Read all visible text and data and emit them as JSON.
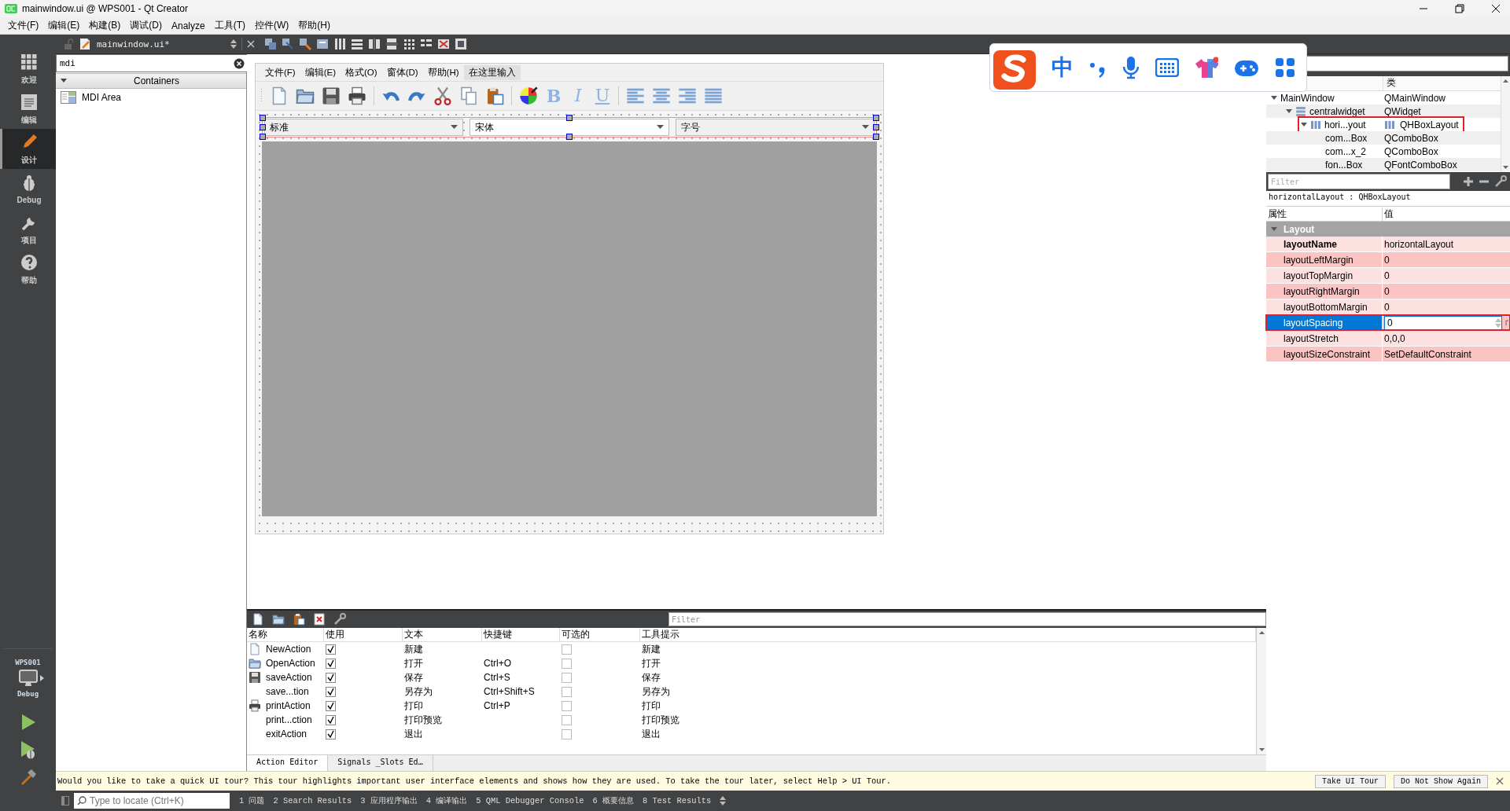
{
  "window": {
    "title": "mainwindow.ui @ WPS001 - Qt Creator"
  },
  "menu": [
    "文件(F)",
    "编辑(E)",
    "构建(B)",
    "调试(D)",
    "Analyze",
    "工具(T)",
    "控件(W)",
    "帮助(H)"
  ],
  "modes": [
    {
      "kind": "welcome",
      "label": "欢迎",
      "selected": false
    },
    {
      "kind": "edit",
      "label": "编辑",
      "selected": false
    },
    {
      "kind": "design",
      "label": "设计",
      "selected": true
    },
    {
      "kind": "debug",
      "label": "Debug",
      "selected": false
    },
    {
      "kind": "projects",
      "label": "项目",
      "selected": false
    },
    {
      "kind": "help",
      "label": "帮助",
      "selected": false
    }
  ],
  "target": {
    "project": "WPS001",
    "build": "Debug"
  },
  "document": {
    "file": "mainwindow.ui*"
  },
  "widget_box": {
    "search": {
      "value": "mdi"
    },
    "categories": [
      {
        "label": "Containers",
        "expanded": true,
        "items": [
          {
            "label": "MDI Area"
          }
        ]
      }
    ]
  },
  "form": {
    "menu": [
      {
        "label": "文件(F)",
        "selected": false
      },
      {
        "label": "编辑(E)",
        "selected": false
      },
      {
        "label": "格式(O)",
        "selected": false
      },
      {
        "label": "窗体(D)",
        "selected": false
      },
      {
        "label": "帮助(H)",
        "selected": false
      },
      {
        "label": "在这里输入",
        "selected": true
      }
    ],
    "format_buttons": [
      "B",
      "I",
      "U"
    ],
    "combos": [
      {
        "kind": "combo",
        "value": "标准"
      },
      {
        "kind": "font",
        "value": "宋体"
      },
      {
        "kind": "combo",
        "value": "字号"
      }
    ]
  },
  "action_editor": {
    "filter": {
      "placeholder": "Filter"
    },
    "columns": [
      "名称",
      "使用",
      "文本",
      "快捷键",
      "可选的",
      "工具提示"
    ],
    "rows": [
      {
        "kind": "new",
        "name": "NewAction",
        "used": true,
        "text": "新建",
        "shortcut": "",
        "checkable": false,
        "tooltip": "新建"
      },
      {
        "kind": "open",
        "name": "OpenAction",
        "used": true,
        "text": "打开",
        "shortcut": "Ctrl+O",
        "checkable": false,
        "tooltip": "打开"
      },
      {
        "kind": "save",
        "name": "saveAction",
        "used": true,
        "text": "保存",
        "shortcut": "Ctrl+S",
        "checkable": false,
        "tooltip": "保存"
      },
      {
        "kind": "plain",
        "name": "save...tion",
        "used": true,
        "text": "另存为",
        "shortcut": "Ctrl+Shift+S",
        "checkable": false,
        "tooltip": "另存为"
      },
      {
        "kind": "print",
        "name": "printAction",
        "used": true,
        "text": "打印",
        "shortcut": "Ctrl+P",
        "checkable": false,
        "tooltip": "打印"
      },
      {
        "kind": "plain",
        "name": "print...ction",
        "used": true,
        "text": "打印预览",
        "shortcut": "",
        "checkable": false,
        "tooltip": "打印预览"
      },
      {
        "kind": "plain",
        "name": "exitAction",
        "used": true,
        "text": "退出",
        "shortcut": "",
        "checkable": false,
        "tooltip": "退出"
      }
    ],
    "tabs": [
      {
        "label": "Action Editor",
        "selected": true
      },
      {
        "label": "Signals _Slots Ed…",
        "selected": false
      }
    ]
  },
  "ime_toolbar": {
    "mode": "中"
  },
  "object_inspector": {
    "columns": [
      "类"
    ],
    "tree": [
      {
        "name": "MainWindow",
        "class": "QMainWindow",
        "expanded": true,
        "highlighted": false,
        "children": [
          {
            "kind": "widget",
            "name": "centralwidget",
            "class": "QWidget",
            "expanded": true,
            "highlighted": false,
            "children": [
              {
                "kind": "hlayout",
                "name": "hori...yout",
                "class": "QHBoxLayout",
                "expanded": true,
                "highlighted": true,
                "children": [
                  {
                    "name": "com...Box",
                    "class": "QComboBox",
                    "highlighted": false
                  },
                  {
                    "name": "com...x_2",
                    "class": "QComboBox",
                    "highlighted": false
                  },
                  {
                    "name": "fon...Box",
                    "class": "QFontComboBox",
                    "highlighted": false
                  }
                ]
              }
            ]
          }
        ]
      }
    ]
  },
  "property_editor": {
    "filter": {
      "placeholder": "Filter"
    },
    "object": "horizontalLayout : QHBoxLayout",
    "columns": [
      "属性",
      "值"
    ],
    "groups": [
      {
        "label": "Layout",
        "expanded": true,
        "properties": [
          {
            "name": "layoutName",
            "value": "horizontalLayout",
            "modified": true,
            "selected": false,
            "highlighted": false
          },
          {
            "name": "layoutLeftMargin",
            "value": "0",
            "modified": false,
            "selected": false,
            "highlighted": false
          },
          {
            "name": "layoutTopMargin",
            "value": "0",
            "modified": false,
            "selected": false,
            "highlighted": false
          },
          {
            "name": "layoutRightMargin",
            "value": "0",
            "modified": false,
            "selected": false,
            "highlighted": false
          },
          {
            "name": "layoutBottomMargin",
            "value": "0",
            "modified": false,
            "selected": false,
            "highlighted": false
          },
          {
            "name": "layoutSpacing",
            "value": "0",
            "modified": false,
            "selected": true,
            "highlighted": true
          },
          {
            "name": "layoutStretch",
            "value": "0,0,0",
            "modified": false,
            "selected": false,
            "highlighted": false
          },
          {
            "name": "layoutSizeConstraint",
            "value": "SetDefaultConstraint",
            "modified": false,
            "selected": false,
            "highlighted": false
          }
        ]
      }
    ]
  },
  "tour_bar": {
    "message": "Would you like to take a quick UI tour? This tour highlights important user interface elements and shows how they are used. To take the tour later, select Help > UI Tour.",
    "buttons": [
      "Take UI Tour",
      "Do Not Show Again"
    ]
  },
  "status_bar": {
    "locate": {
      "placeholder": "Type to locate (Ctrl+K)"
    },
    "panes": [
      "1 问题",
      "2 Search Results",
      "3 应用程序输出",
      "4 编译输出",
      "5 QML Debugger Console",
      "6 概要信息",
      "8 Test Results"
    ]
  }
}
